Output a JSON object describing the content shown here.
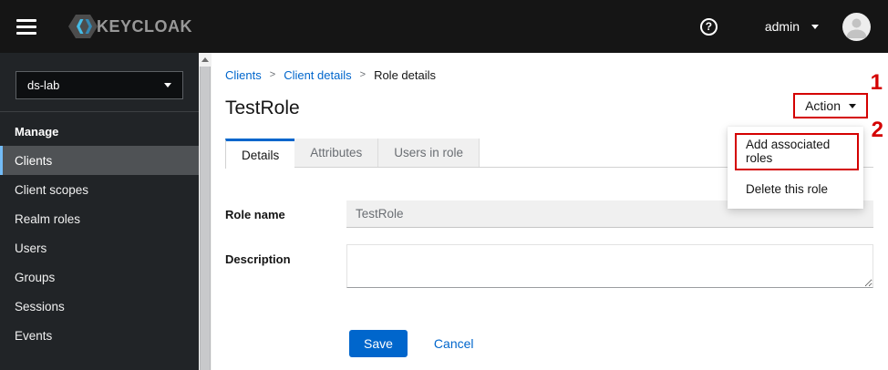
{
  "topbar": {
    "brand": "KEYCLOAK",
    "username": "admin"
  },
  "sidebar": {
    "realm": "ds-lab",
    "section_label": "Manage",
    "items": [
      {
        "label": "Clients",
        "selected": true
      },
      {
        "label": "Client scopes",
        "selected": false
      },
      {
        "label": "Realm roles",
        "selected": false
      },
      {
        "label": "Users",
        "selected": false
      },
      {
        "label": "Groups",
        "selected": false
      },
      {
        "label": "Sessions",
        "selected": false
      },
      {
        "label": "Events",
        "selected": false
      }
    ]
  },
  "breadcrumb": {
    "separator": ">",
    "items": [
      {
        "label": "Clients",
        "link": true
      },
      {
        "label": "Client details",
        "link": true
      },
      {
        "label": "Role details",
        "link": false
      }
    ]
  },
  "page": {
    "title": "TestRole"
  },
  "action_menu": {
    "button_label": "Action",
    "items": [
      {
        "label": "Add associated roles"
      },
      {
        "label": "Delete this role"
      }
    ]
  },
  "annotations": {
    "step1": "1",
    "step2": "2",
    "color": "#d40000"
  },
  "tabs": [
    {
      "label": "Details",
      "active": true
    },
    {
      "label": "Attributes",
      "active": false
    },
    {
      "label": "Users in role",
      "active": false
    }
  ],
  "form": {
    "role_name": {
      "label": "Role name",
      "value": "TestRole"
    },
    "description": {
      "label": "Description",
      "value": ""
    },
    "save_label": "Save",
    "cancel_label": "Cancel"
  },
  "colors": {
    "primary_blue": "#0066cc",
    "topbar_bg": "#151515",
    "sidebar_bg": "#212427",
    "selected_nav_bg": "#4f5255",
    "selected_nav_border": "#73bcf7",
    "annotation_red": "#d40000"
  }
}
